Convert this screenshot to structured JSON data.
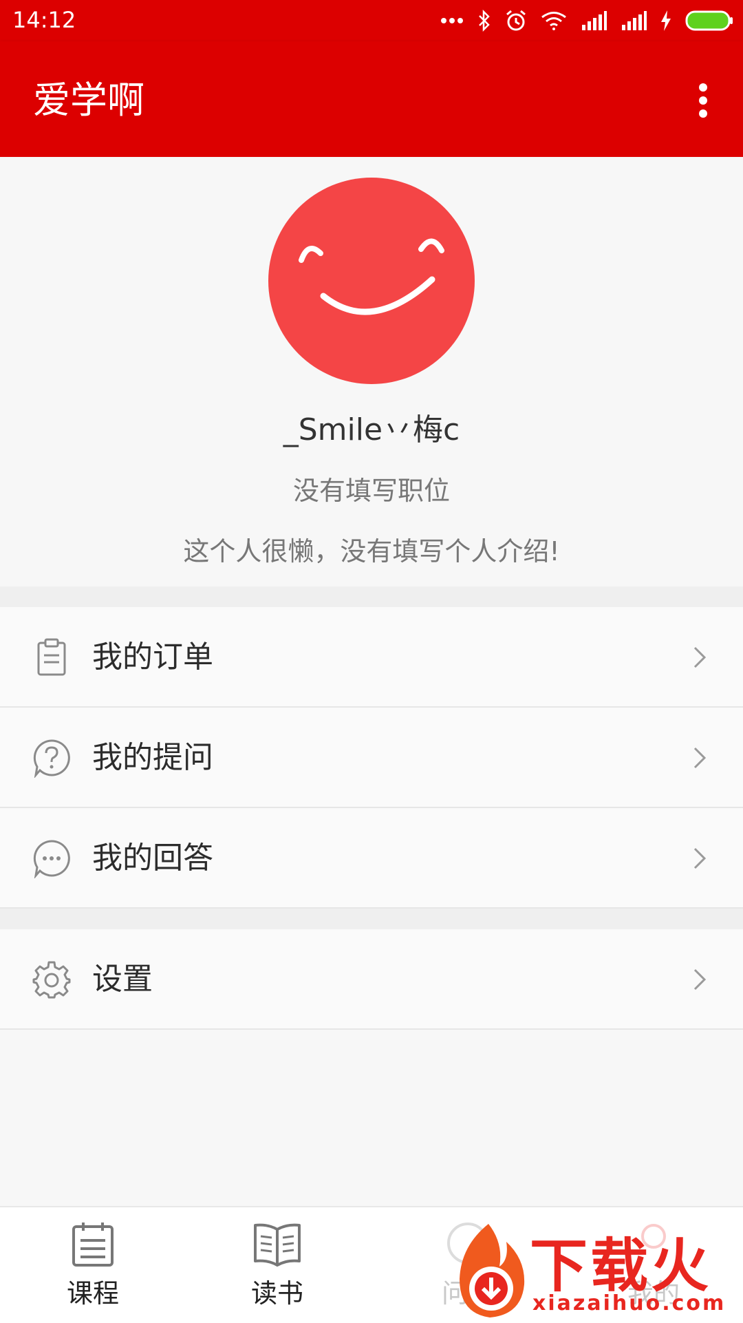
{
  "status_bar": {
    "time": "14:12",
    "icons": [
      "more-dots-icon",
      "bluetooth-icon",
      "alarm-icon",
      "wifi-icon",
      "signal-icon",
      "signal-icon",
      "charging-icon",
      "battery-icon"
    ]
  },
  "app_bar": {
    "title": "爱学啊",
    "overflow_icon": "more-vert-icon",
    "color": "#dc0000"
  },
  "profile": {
    "avatar_color": "#f44546",
    "username": "_Smile丷梅c",
    "position": "没有填写职位",
    "intro": "这个人很懒，没有填写个人介绍!"
  },
  "menu": {
    "orders": {
      "label": "我的订单",
      "icon": "clipboard-icon"
    },
    "questions": {
      "label": "我的提问",
      "icon": "question-bubble-icon"
    },
    "answers": {
      "label": "我的回答",
      "icon": "chat-bubble-icon"
    },
    "settings": {
      "label": "设置",
      "icon": "gear-icon"
    }
  },
  "bottom_nav": {
    "items": [
      {
        "label": "课程",
        "icon": "calendar-list-icon"
      },
      {
        "label": "读书",
        "icon": "open-book-icon"
      },
      {
        "label": "问答",
        "icon": "qa-icon"
      },
      {
        "label": "我的",
        "icon": "profile-icon"
      }
    ]
  },
  "watermark": {
    "text": "下载火",
    "url": "xiazaihuo.com",
    "color": "#e8261f"
  }
}
